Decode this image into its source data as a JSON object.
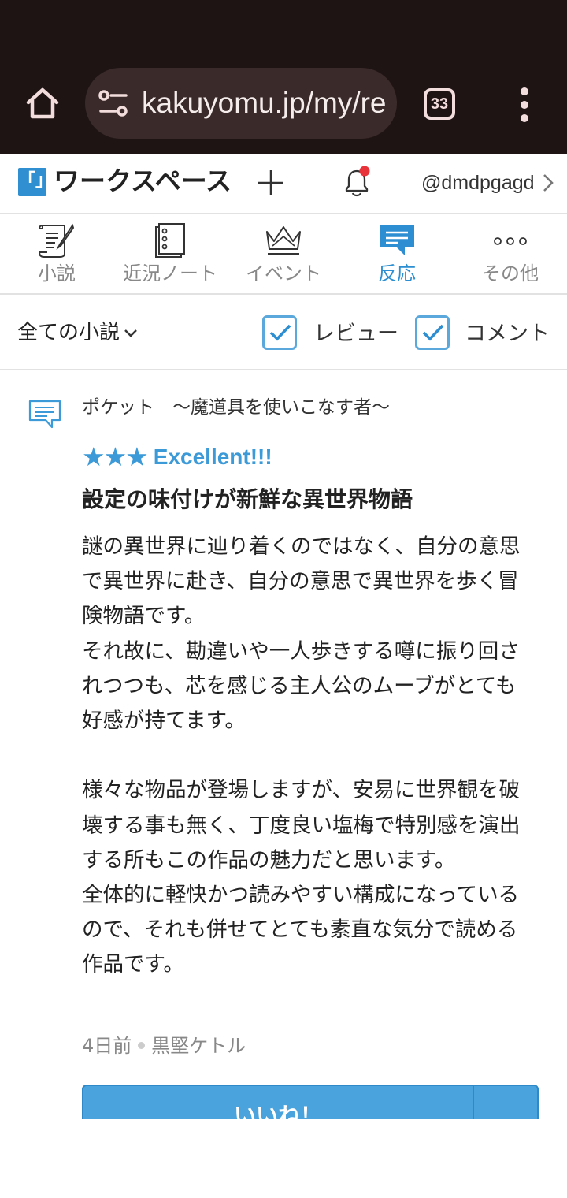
{
  "browser": {
    "url": "kakuyomu.jp/my/re",
    "tab_count": "33"
  },
  "header": {
    "logo_text": "「」",
    "title": "ワークスペース",
    "user": "@dmdpgagd",
    "has_notification": true
  },
  "nav": {
    "tabs": [
      {
        "label": "小説",
        "icon": "scroll-quill-icon",
        "active": false
      },
      {
        "label": "近況ノート",
        "icon": "notebook-icon",
        "active": false
      },
      {
        "label": "イベント",
        "icon": "crown-icon",
        "active": false
      },
      {
        "label": "反応",
        "icon": "speech-bubble-icon",
        "active": true
      },
      {
        "label": "その他",
        "icon": "more-dots-icon",
        "active": false
      }
    ]
  },
  "filter": {
    "novel_select": "全ての小説",
    "review_label": "レビュー",
    "review_checked": true,
    "comment_label": "コメント",
    "comment_checked": true
  },
  "review": {
    "novel_title": "ポケット　～魔道具を使いこなす者～",
    "stars": "★★★",
    "rating_label": "Excellent!!!",
    "title": "設定の味付けが新鮮な異世界物語",
    "body": "謎の異世界に辿り着くのではなく、自分の意思で異世界に赴き、自分の意思で異世界を歩く冒険物語です。\nそれ故に、勘違いや一人歩きする噂に振り回されつつも、芯を感じる主人公のムーブがとても好感が持てます。\n\n様々な物品が登場しますが、安易に世界観を破壊する事も無く、丁度良い塩梅で特別感を演出する所もこの作品の魅力だと思います。\n全体的に軽快かつ読みやすい構成になっているので、それも併せてとても素直な気分で読める作品です。",
    "time": "4日前",
    "author": "黒堅ケトル",
    "like_label": "いいね！"
  },
  "colors": {
    "browser_bg": "#1f1414",
    "accent": "#2d8fd1",
    "star": "#3c9ad8",
    "button": "#4aa3dd",
    "notification_dot": "#e8333a"
  }
}
